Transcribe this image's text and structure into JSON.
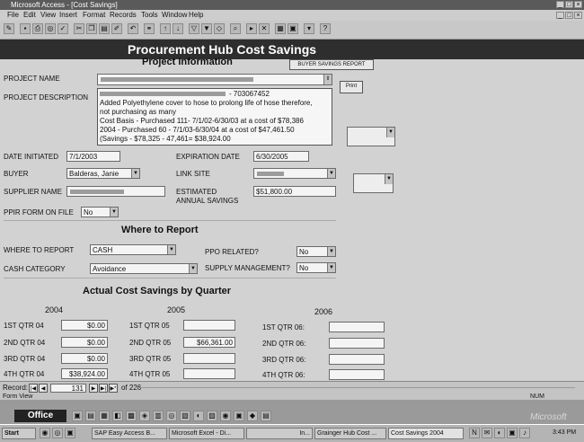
{
  "window": {
    "title": "Microsoft Access - [Cost Savings]",
    "min": "_",
    "max": "□",
    "close": "×"
  },
  "menu": [
    "File",
    "Edit",
    "View",
    "Insert",
    "Format",
    "Records",
    "Tools",
    "Window",
    "Help"
  ],
  "form": {
    "banner": "Procurement Hub Cost Savings",
    "section_project": "Project Information",
    "buyer_savings_report_btn": "BUYER SAVINGS REPORT",
    "print_btn": "Print",
    "project_name_label": "PROJECT NAME",
    "project_description_label": "PROJECT DESCRIPTION",
    "description_lines": [
      "- 703067452",
      "Added Polyethylene cover to hose to prolong life of hose therefore,",
      "not purchasing as many",
      "Cost Basis - Purchased 111- 7/1/02-6/30/03 at a cost of $78,386",
      "2004 - Purchased 60 - 7/1/03-6/30/04 at a cost of $47,461.50",
      "(Savings - $78,325 - 47,461= $38,924.00"
    ],
    "date_initiated_label": "DATE INITIATED",
    "date_initiated": "7/1/2003",
    "expiration_date_label": "EXPIRATION DATE",
    "expiration_date": "6/30/2005",
    "buyer_label": "BUYER",
    "buyer": "Balderas, Janie",
    "link_site_label": "LINK SITE",
    "supplier_name_label": "SUPPLIER NAME",
    "estimated_savings_label_1": "ESTIMATED",
    "estimated_savings_label_2": "ANNUAL SAVINGS",
    "estimated_savings": "$51,800.00",
    "ppir_label": "PPIR FORM ON FILE",
    "ppir": "No",
    "section_report": "Where to Report",
    "where_to_report_label": "WHERE TO REPORT",
    "where_to_report": "CASH",
    "ppo_related_label": "PPO RELATED?",
    "ppo_related": "No",
    "cash_category_label": "CASH CATEGORY",
    "cash_category": "Avoidance",
    "supply_mgmt_label": "SUPPLY MANAGEMENT?",
    "supply_mgmt": "No",
    "section_actual": "Actual Cost Savings by Quarter",
    "years": [
      "2004",
      "2005",
      "2006"
    ],
    "q2004": [
      {
        "label": "1ST QTR 04",
        "value": "$0.00"
      },
      {
        "label": "2ND QTR 04",
        "value": "$0.00"
      },
      {
        "label": "3RD QTR 04",
        "value": "$0.00"
      },
      {
        "label": "4TH QTR 04",
        "value": "$38,924.00"
      }
    ],
    "q2005": [
      {
        "label": "1ST QTR 05",
        "value": ""
      },
      {
        "label": "2ND QTR 05",
        "value": "$66,361.00"
      },
      {
        "label": "3RD QTR 05",
        "value": ""
      },
      {
        "label": "4TH QTR 05",
        "value": ""
      }
    ],
    "q2006": [
      {
        "label": "1ST QTR 06:",
        "value": ""
      },
      {
        "label": "2ND QTR 06:",
        "value": ""
      },
      {
        "label": "3RD QTR 06:",
        "value": ""
      },
      {
        "label": "4TH QTR 06:",
        "value": ""
      }
    ]
  },
  "status": {
    "record_label": "Record:",
    "record_number": "131",
    "record_total": "of 226",
    "form_view": "Form View",
    "num": "NUM"
  },
  "office_bar": {
    "label": "Office",
    "brand": "Microsoft"
  },
  "taskbar": {
    "start": "Start",
    "tasks": [
      "SAP Easy Access B...",
      "Microsoft Excel - Di...",
      "In...",
      "Grainger Hub Cost ...",
      "Cost Savings 2004"
    ],
    "clock": "3:43 PM"
  }
}
